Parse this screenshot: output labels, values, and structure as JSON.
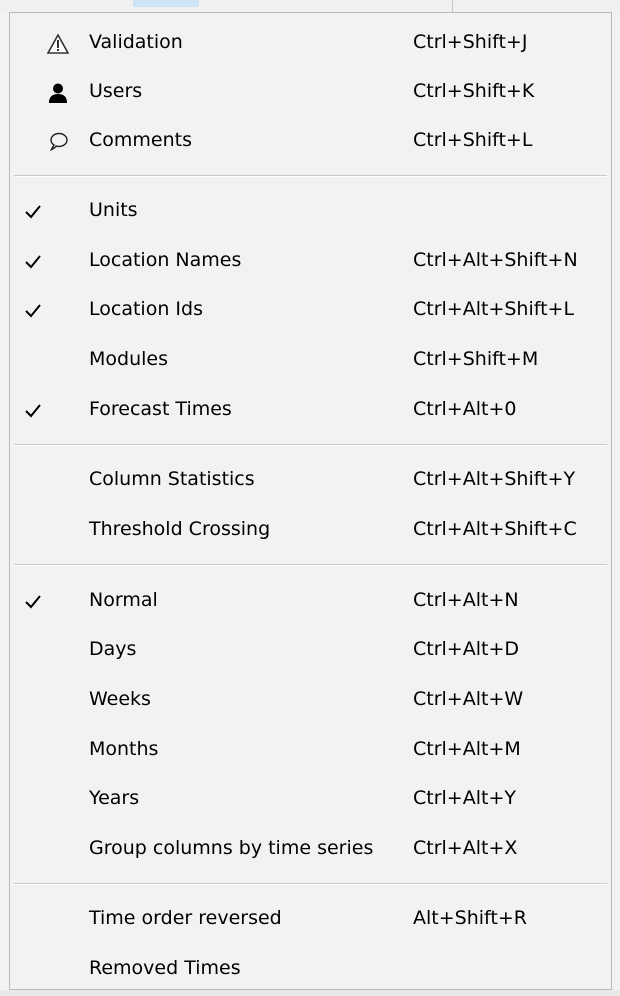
{
  "menu": {
    "items": [
      {
        "label": "Validation",
        "shortcut": "Ctrl+Shift+J",
        "icon": "warning-triangle-icon",
        "checked": false
      },
      {
        "label": "Users",
        "shortcut": "Ctrl+Shift+K",
        "icon": "user-icon",
        "checked": false
      },
      {
        "label": "Comments",
        "shortcut": "Ctrl+Shift+L",
        "icon": "speech-bubble-icon",
        "checked": false
      },
      {
        "label": "Units",
        "shortcut": "",
        "checked": true
      },
      {
        "label": "Location Names",
        "shortcut": "Ctrl+Alt+Shift+N",
        "checked": true
      },
      {
        "label": "Location Ids",
        "shortcut": "Ctrl+Alt+Shift+L",
        "checked": true
      },
      {
        "label": "Modules",
        "shortcut": "Ctrl+Shift+M",
        "checked": false
      },
      {
        "label": "Forecast Times",
        "shortcut": "Ctrl+Alt+0",
        "checked": true
      },
      {
        "label": "Column Statistics",
        "shortcut": "Ctrl+Alt+Shift+Y",
        "checked": false
      },
      {
        "label": "Threshold Crossing",
        "shortcut": "Ctrl+Alt+Shift+C",
        "checked": false
      },
      {
        "label": "Normal",
        "shortcut": "Ctrl+Alt+N",
        "checked": true
      },
      {
        "label": "Days",
        "shortcut": "Ctrl+Alt+D",
        "checked": false
      },
      {
        "label": "Weeks",
        "shortcut": "Ctrl+Alt+W",
        "checked": false
      },
      {
        "label": "Months",
        "shortcut": "Ctrl+Alt+M",
        "checked": false
      },
      {
        "label": "Years",
        "shortcut": "Ctrl+Alt+Y",
        "checked": false
      },
      {
        "label": "Group columns by time series",
        "shortcut": "Ctrl+Alt+X",
        "checked": false
      },
      {
        "label": "Time order reversed",
        "shortcut": "Alt+Shift+R",
        "checked": false
      },
      {
        "label": "Removed Times",
        "shortcut": "",
        "checked": false
      }
    ]
  },
  "colors": {
    "menu_background": "#f2f2f2",
    "separator": "#c9c9c9",
    "text": "#000000"
  }
}
